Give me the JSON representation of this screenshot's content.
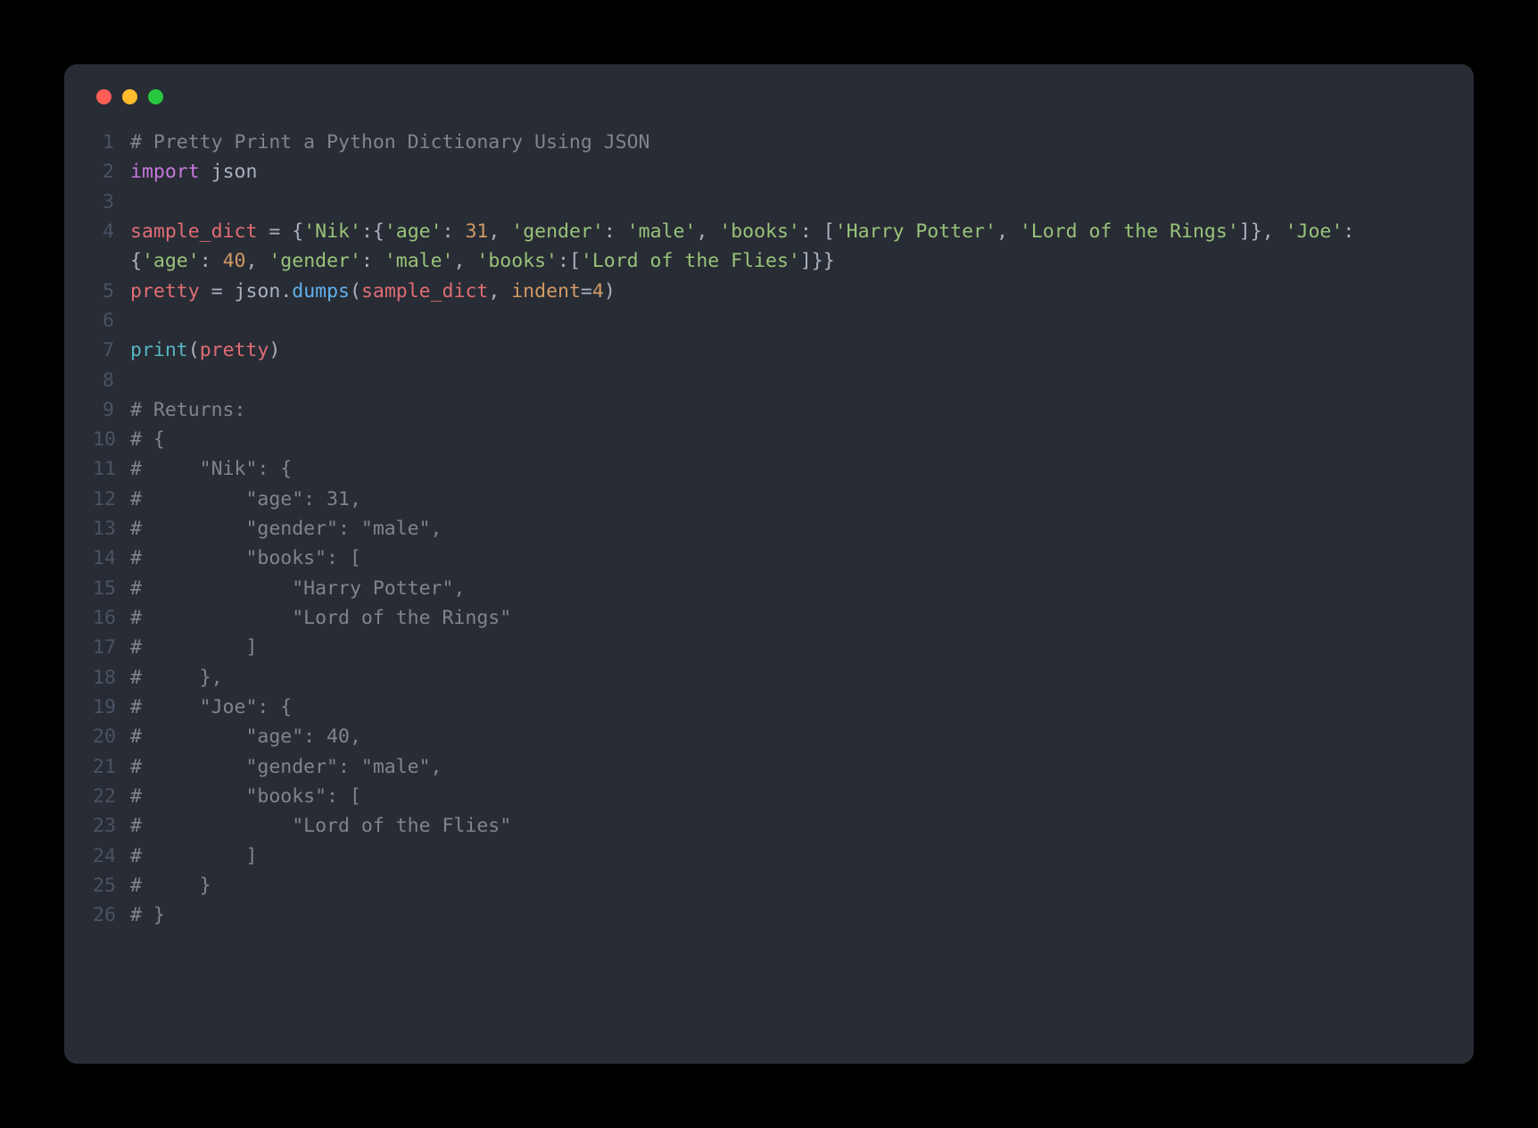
{
  "traffic_lights": {
    "red": "close-icon",
    "yellow": "minimize-icon",
    "green": "zoom-icon"
  },
  "colors": {
    "window_bg": "#282c34",
    "page_bg": "#000000",
    "lineno": "#4b5363",
    "default": "#abb2bf",
    "comment": "#7f848e",
    "keyword": "#c678dd",
    "identifier": "#e06c75",
    "string": "#98c379",
    "number": "#d19a66",
    "function": "#61afef",
    "builtin": "#56b6c2",
    "kwarg": "#d19a66",
    "red_btn": "#ff5f57",
    "yellow_btn": "#febc2e",
    "green_btn": "#28c840"
  },
  "line_numbers": [
    "1",
    "2",
    "3",
    "4",
    "5",
    "6",
    "7",
    "8",
    "9",
    "10",
    "11",
    "12",
    "13",
    "14",
    "15",
    "16",
    "17",
    "18",
    "19",
    "20",
    "21",
    "22",
    "23",
    "24",
    "25",
    "26"
  ],
  "lines": {
    "l1": {
      "t1": "# Pretty Print a Python Dictionary Using JSON"
    },
    "l2": {
      "t1": "import",
      "t2": " ",
      "t3": "json"
    },
    "l3": {},
    "l4": {
      "t1": "sample_dict",
      "t2": " ",
      "t3": "=",
      "t4": " ",
      "t5": "{",
      "t6": "'Nik'",
      "t7": ":",
      "t8": "{",
      "t9": "'age'",
      "t10": ": ",
      "t11": "31",
      "t12": ", ",
      "t13": "'gender'",
      "t14": ": ",
      "t15": "'male'",
      "t16": ", ",
      "t17": "'books'",
      "t18": ": ",
      "t19": "[",
      "t20": "'Harry Potter'",
      "t21": ", ",
      "t22": "'Lord of the Rings'",
      "t23": "]",
      "t24": "}",
      "t25": ", ",
      "t26": "'Joe'",
      "t27": ": ",
      "t28": "{",
      "t29": "'age'",
      "t30": ": ",
      "t31": "40",
      "t32": ", ",
      "t33": "'gender'",
      "t34": ": ",
      "t35": "'male'",
      "t36": ", ",
      "t37": "'books'",
      "t38": ":",
      "t39": "[",
      "t40": "'Lord of the Flies'",
      "t41": "]",
      "t42": "}",
      "t43": "}"
    },
    "l5": {
      "t1": "pretty",
      "t2": " ",
      "t3": "=",
      "t4": " ",
      "t5": "json",
      "t6": ".",
      "t7": "dumps",
      "t8": "(",
      "t9": "sample_dict",
      "t10": ", ",
      "t11": "indent",
      "t12": "=",
      "t13": "4",
      "t14": ")"
    },
    "l6": {},
    "l7": {
      "t1": "print",
      "t2": "(",
      "t3": "pretty",
      "t4": ")"
    },
    "l8": {},
    "l9": {
      "t1": "# Returns:"
    },
    "l10": {
      "t1": "# {"
    },
    "l11": {
      "t1": "#     \"Nik\": {"
    },
    "l12": {
      "t1": "#         \"age\": 31,"
    },
    "l13": {
      "t1": "#         \"gender\": \"male\","
    },
    "l14": {
      "t1": "#         \"books\": ["
    },
    "l15": {
      "t1": "#             \"Harry Potter\","
    },
    "l16": {
      "t1": "#             \"Lord of the Rings\""
    },
    "l17": {
      "t1": "#         ]"
    },
    "l18": {
      "t1": "#     },"
    },
    "l19": {
      "t1": "#     \"Joe\": {"
    },
    "l20": {
      "t1": "#         \"age\": 40,"
    },
    "l21": {
      "t1": "#         \"gender\": \"male\","
    },
    "l22": {
      "t1": "#         \"books\": ["
    },
    "l23": {
      "t1": "#             \"Lord of the Flies\""
    },
    "l24": {
      "t1": "#         ]"
    },
    "l25": {
      "t1": "#     }"
    },
    "l26": {
      "t1": "# }"
    }
  }
}
